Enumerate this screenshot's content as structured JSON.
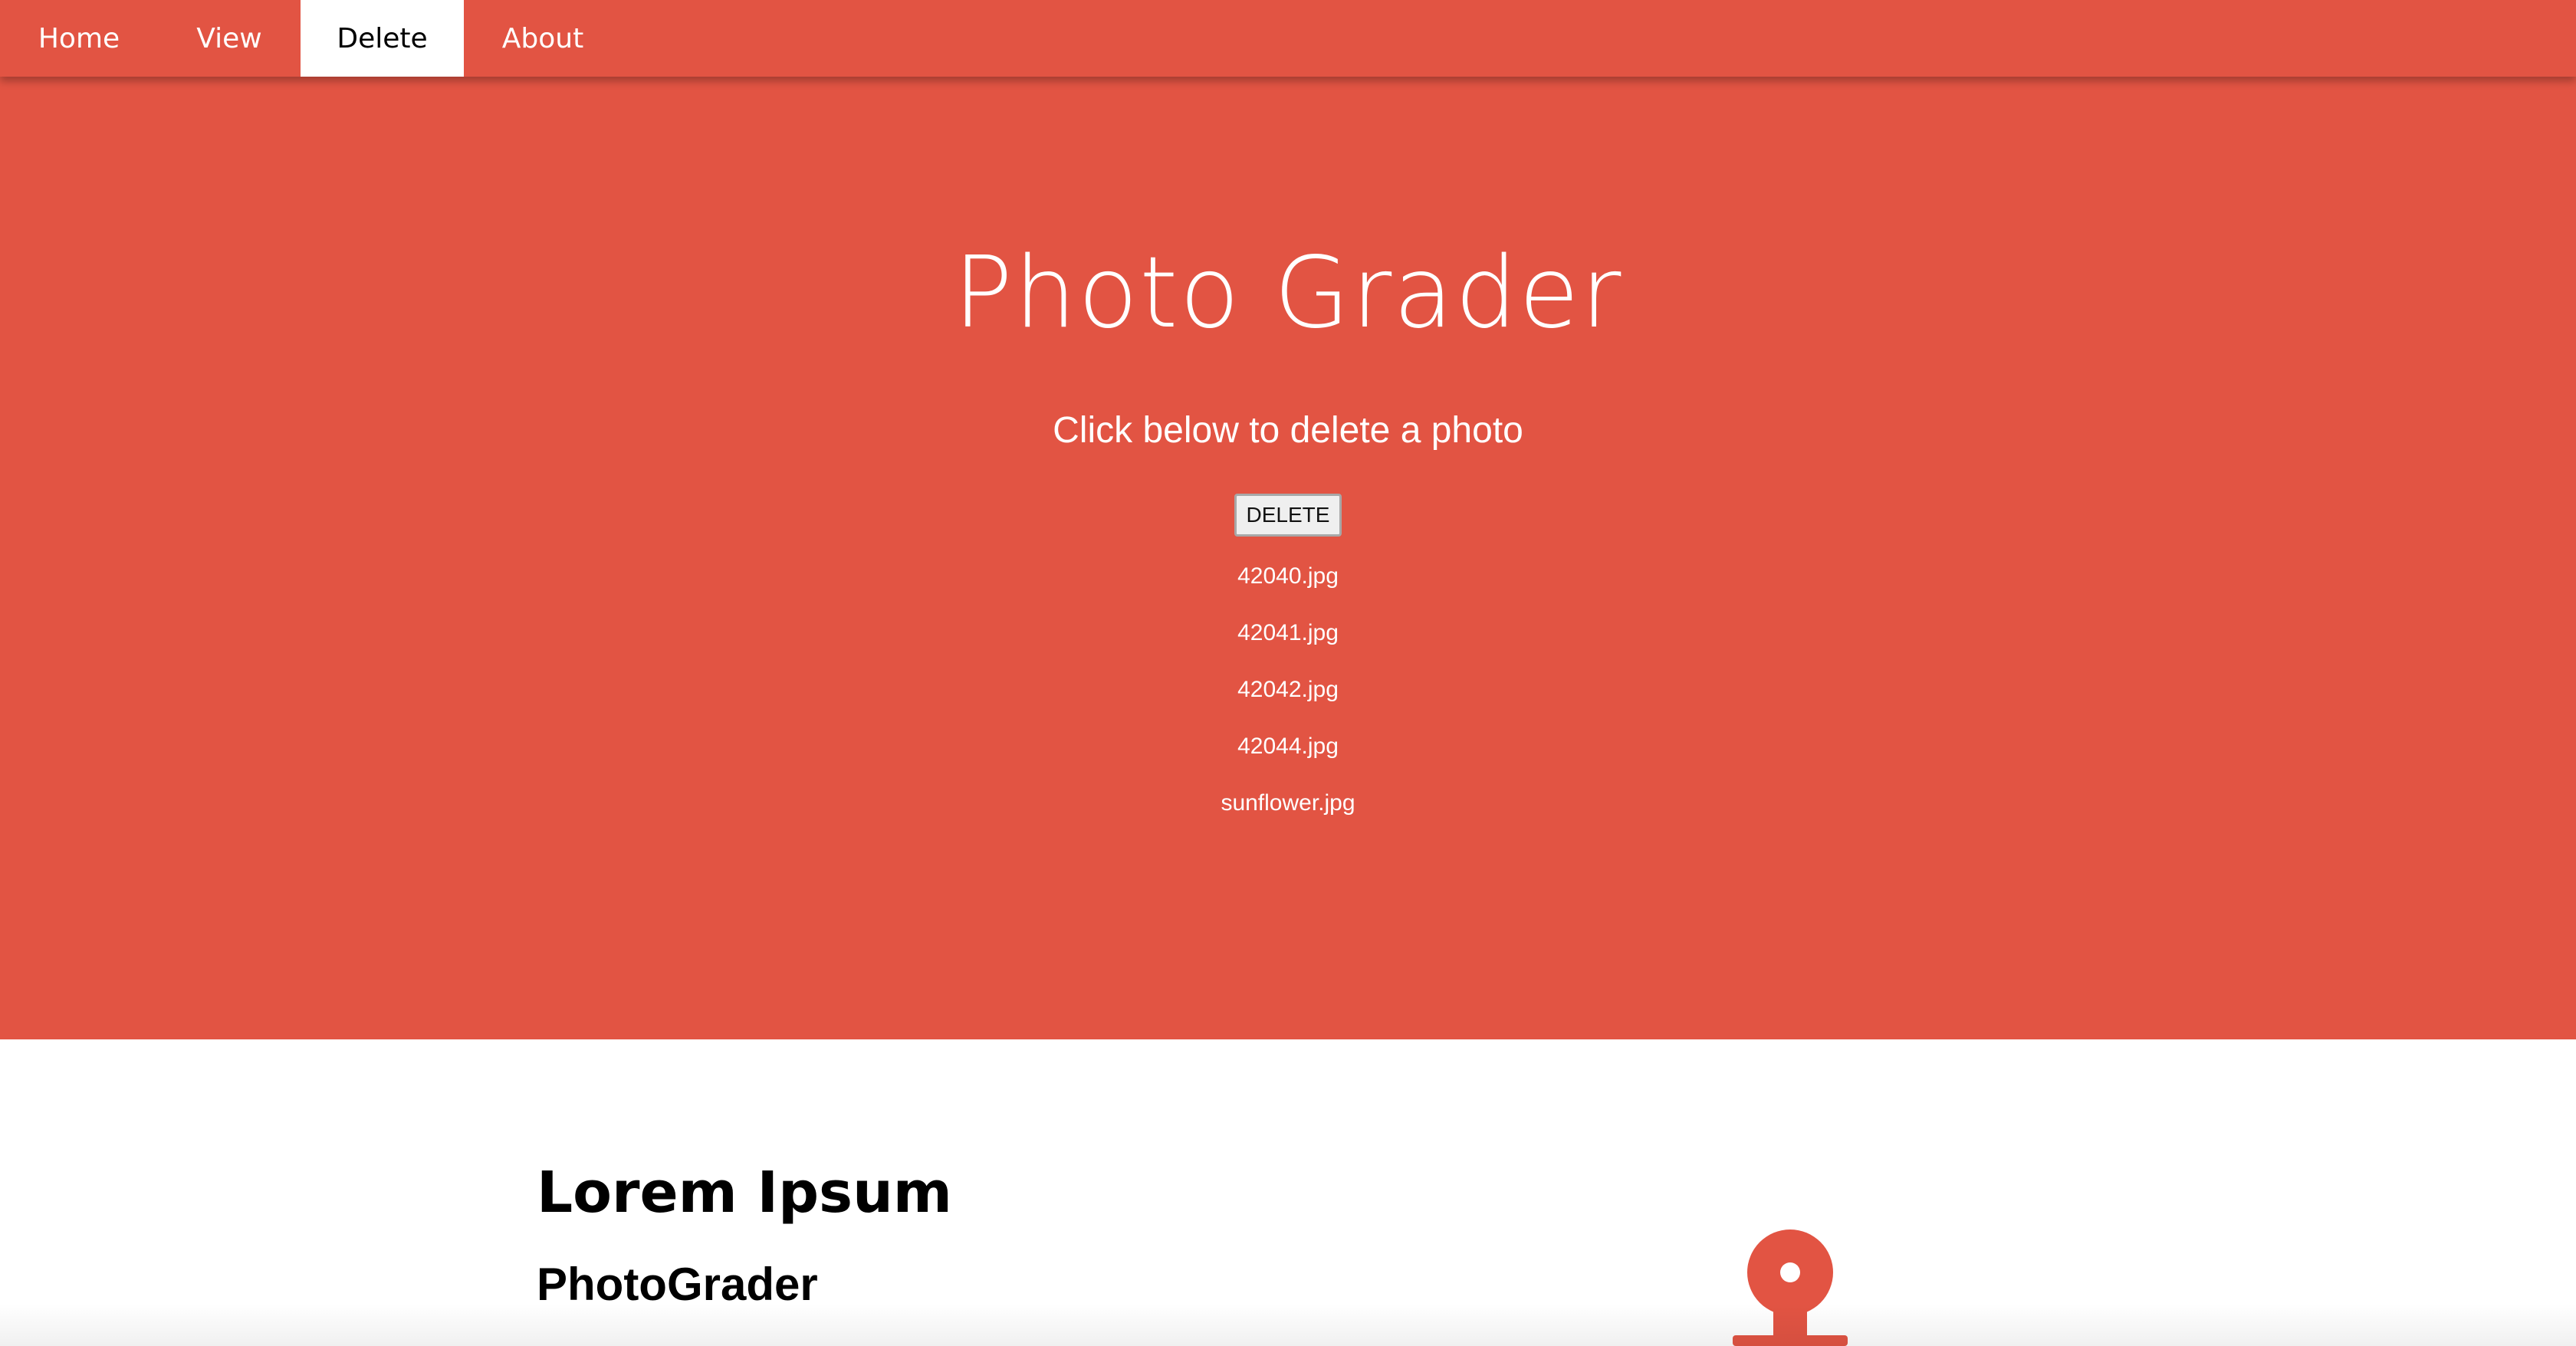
{
  "nav": {
    "items": [
      {
        "label": "Home",
        "active": false
      },
      {
        "label": "View",
        "active": false
      },
      {
        "label": "Delete",
        "active": true
      },
      {
        "label": "About",
        "active": false
      }
    ]
  },
  "hero": {
    "title": "Photo Grader",
    "subtitle": "Click below to delete a photo",
    "delete_button": "DELETE",
    "files": [
      "42040.jpg",
      "42041.jpg",
      "42042.jpg",
      "42044.jpg",
      "sunflower.jpg"
    ]
  },
  "content": {
    "heading": "Lorem Ipsum",
    "subheading": "PhotoGrader"
  },
  "icons": {
    "pin": "pin-icon"
  },
  "colors": {
    "accent": "#e25443",
    "nav_active_bg": "#ffffff",
    "text_light": "#ffffff",
    "text_dark": "#000000"
  }
}
